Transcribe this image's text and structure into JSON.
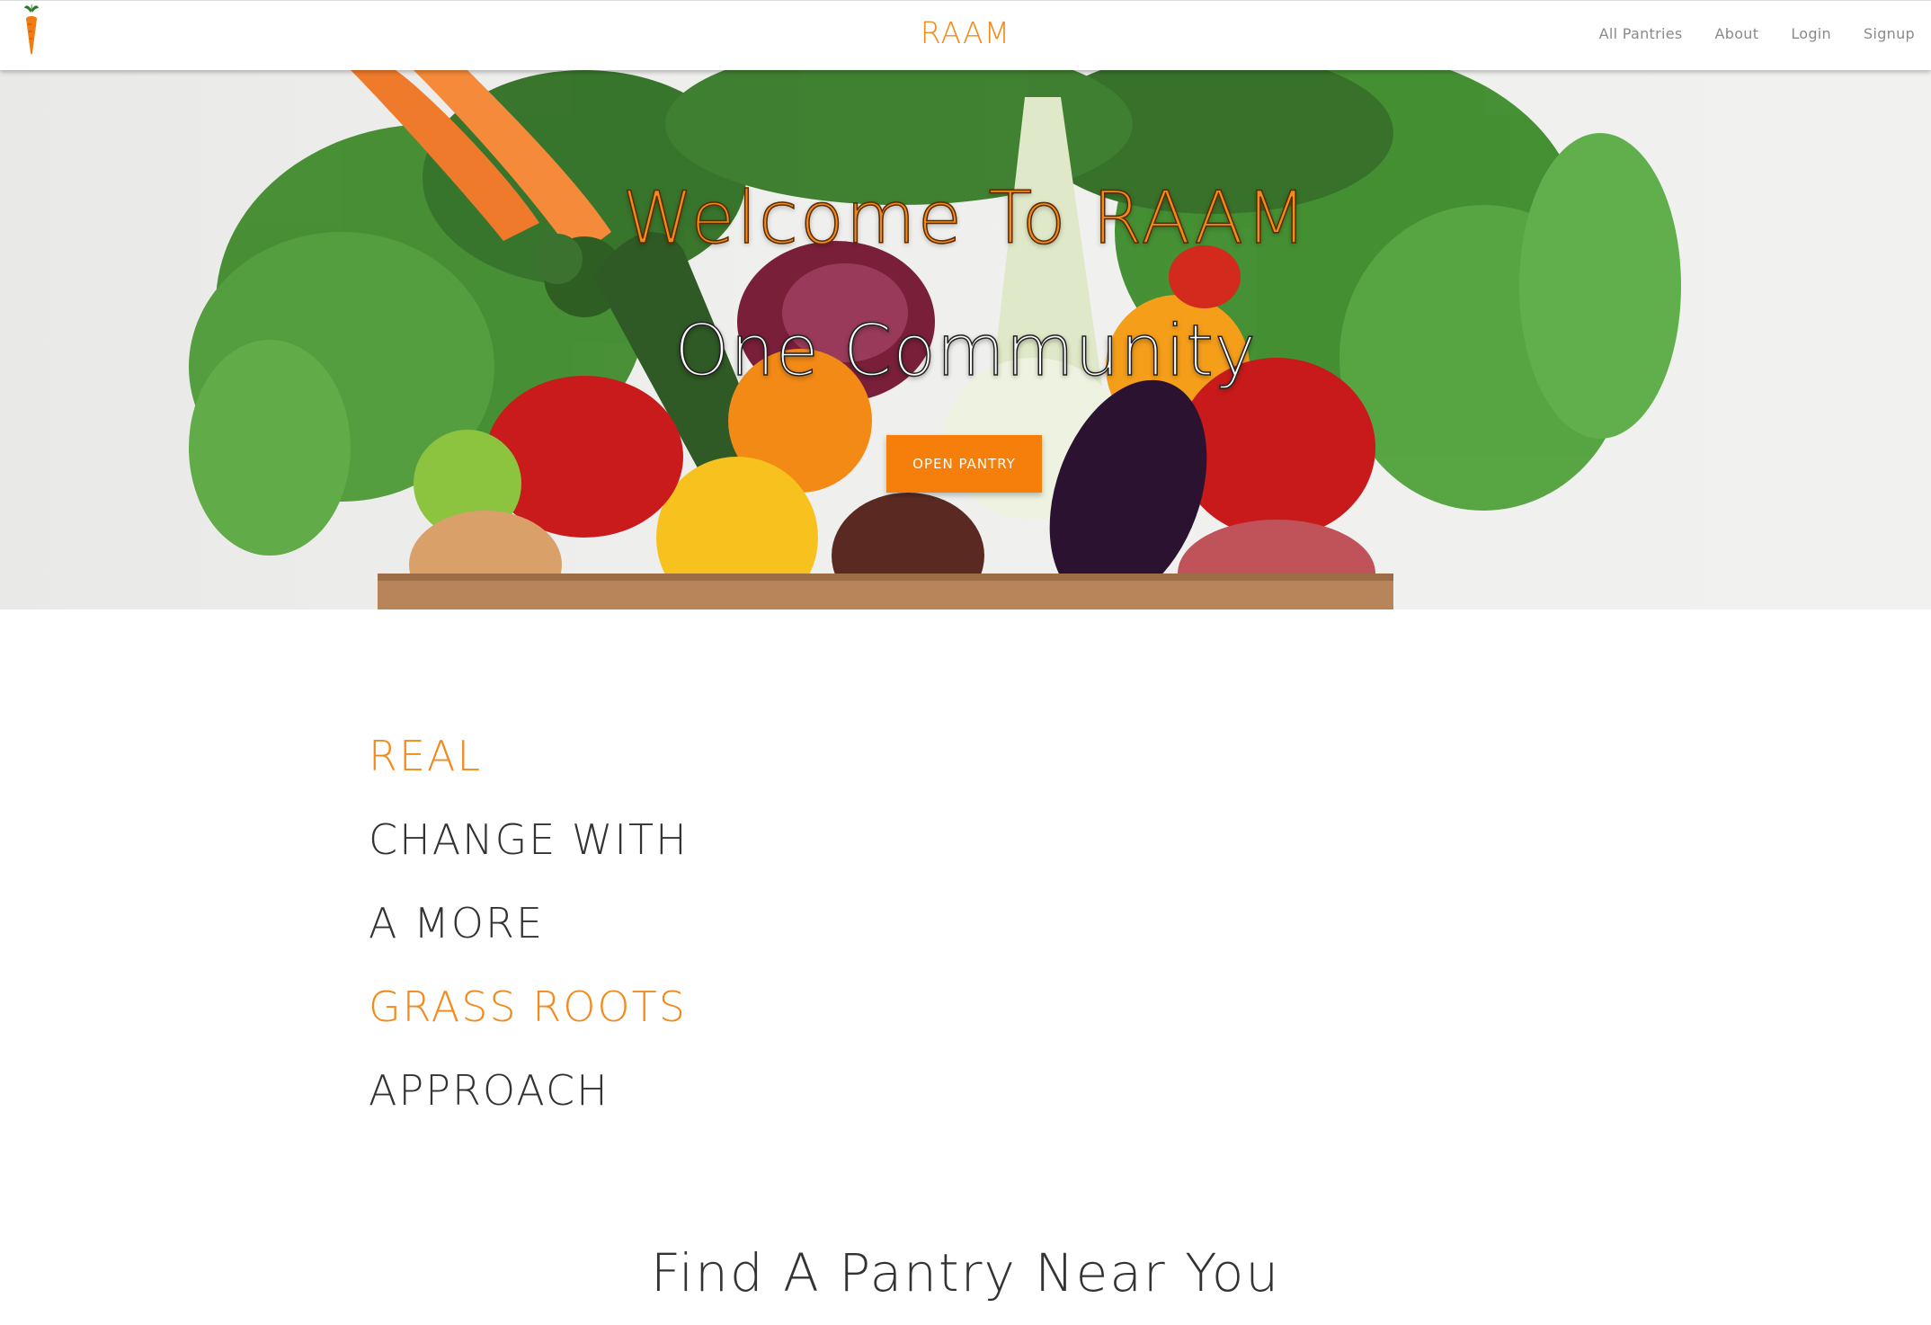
{
  "brand": {
    "title": "RAAM",
    "logo_icon": "carrot-icon"
  },
  "nav": {
    "links": [
      "All Pantries",
      "About",
      "Login",
      "Signup"
    ]
  },
  "hero": {
    "title": "Welcome To RAAM",
    "subtitle": "One Community",
    "button_label": "OPEN PANTRY",
    "image": "vegetable-box-image"
  },
  "tagline": {
    "lines": [
      "REAL",
      "CHANGE WITH",
      "A MORE",
      "GRASS ROOTS",
      "APPROACH"
    ],
    "highlighted_lines": [
      0,
      3
    ]
  },
  "find_section": {
    "heading": "Find A Pantry Near You"
  },
  "colors": {
    "accent": "#f28a1c",
    "button": "#f57f0a",
    "text_dark": "#333333",
    "nav_text": "#8a8a8a"
  }
}
